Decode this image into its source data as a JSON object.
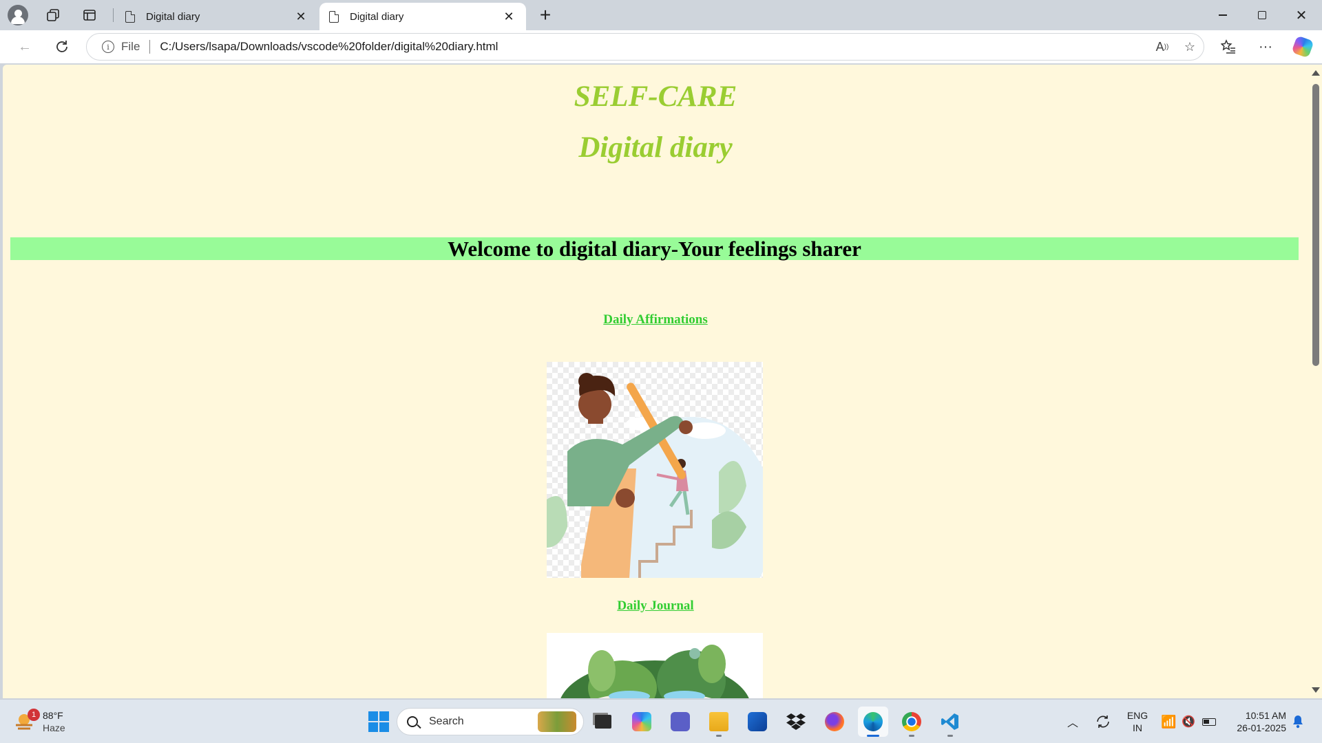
{
  "tabs": [
    {
      "label": "Digital diary",
      "active": false
    },
    {
      "label": "Digital diary",
      "active": true
    }
  ],
  "toolbar": {
    "scheme": "File",
    "url": "C:/Users/lsapa/Downloads/vscode%20folder/digital%20diary.html"
  },
  "page": {
    "title": "SELF-CARE",
    "subtitle": "Digital diary",
    "welcome": "Welcome to digital diary-Your feelings sharer",
    "affirmations_link": "Daily Affirmations",
    "journal_link": "Daily Journal",
    "colors": {
      "heading": "#9acd32",
      "banner": "#98fb98",
      "link": "#32cd32",
      "background": "#fff8dc"
    }
  },
  "taskbar": {
    "weather_temp": "88°F",
    "weather_cond": "Haze",
    "weather_badge": "1",
    "search_placeholder": "Search",
    "lang_top": "ENG",
    "lang_bottom": "IN",
    "time": "10:51 AM",
    "date": "26-01-2025"
  }
}
